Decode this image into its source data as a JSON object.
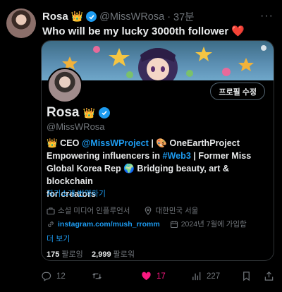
{
  "tweet": {
    "name": "Rosa",
    "crown": "👑",
    "handle": "@MissWRosa",
    "dot": "·",
    "time": "37분",
    "more": "···",
    "text": "Who will be my lucky 3000th follower",
    "heart": "❤️"
  },
  "card": {
    "follow_button": "프로필 수정",
    "name": "Rosa",
    "crown": "👑",
    "handle": "@MissWRosa",
    "bio": {
      "l1a": "👑 CEO ",
      "l1link": "@MissWProject",
      "l1b": " | 🎨 OneEarthProject",
      "l2a": "Empowering influencers in ",
      "l2link": "#Web3",
      "l2b": " | Former Miss",
      "l3": "Global Korea Rep 🌍 Bridging beauty, art & blockchain",
      "l4": "for creators"
    },
    "translate": "자기소개 번역하기",
    "category": "소셜 미디어 인플루언서",
    "location": "대한민국 서울",
    "website": "instagram.com/mush_rromm",
    "joined": "2024년 7월에 가입함",
    "show_more": "더 보기",
    "following_count": "175",
    "following_label": "팔로잉",
    "followers_count": "2,999",
    "followers_label": "팔로워"
  },
  "actions": {
    "replies": "12",
    "retweets": "",
    "likes": "17",
    "views": "227"
  },
  "colors": {
    "accent": "#1d9bf0",
    "like": "#f91880",
    "muted": "#71767b",
    "text": "#e7e9ea"
  }
}
